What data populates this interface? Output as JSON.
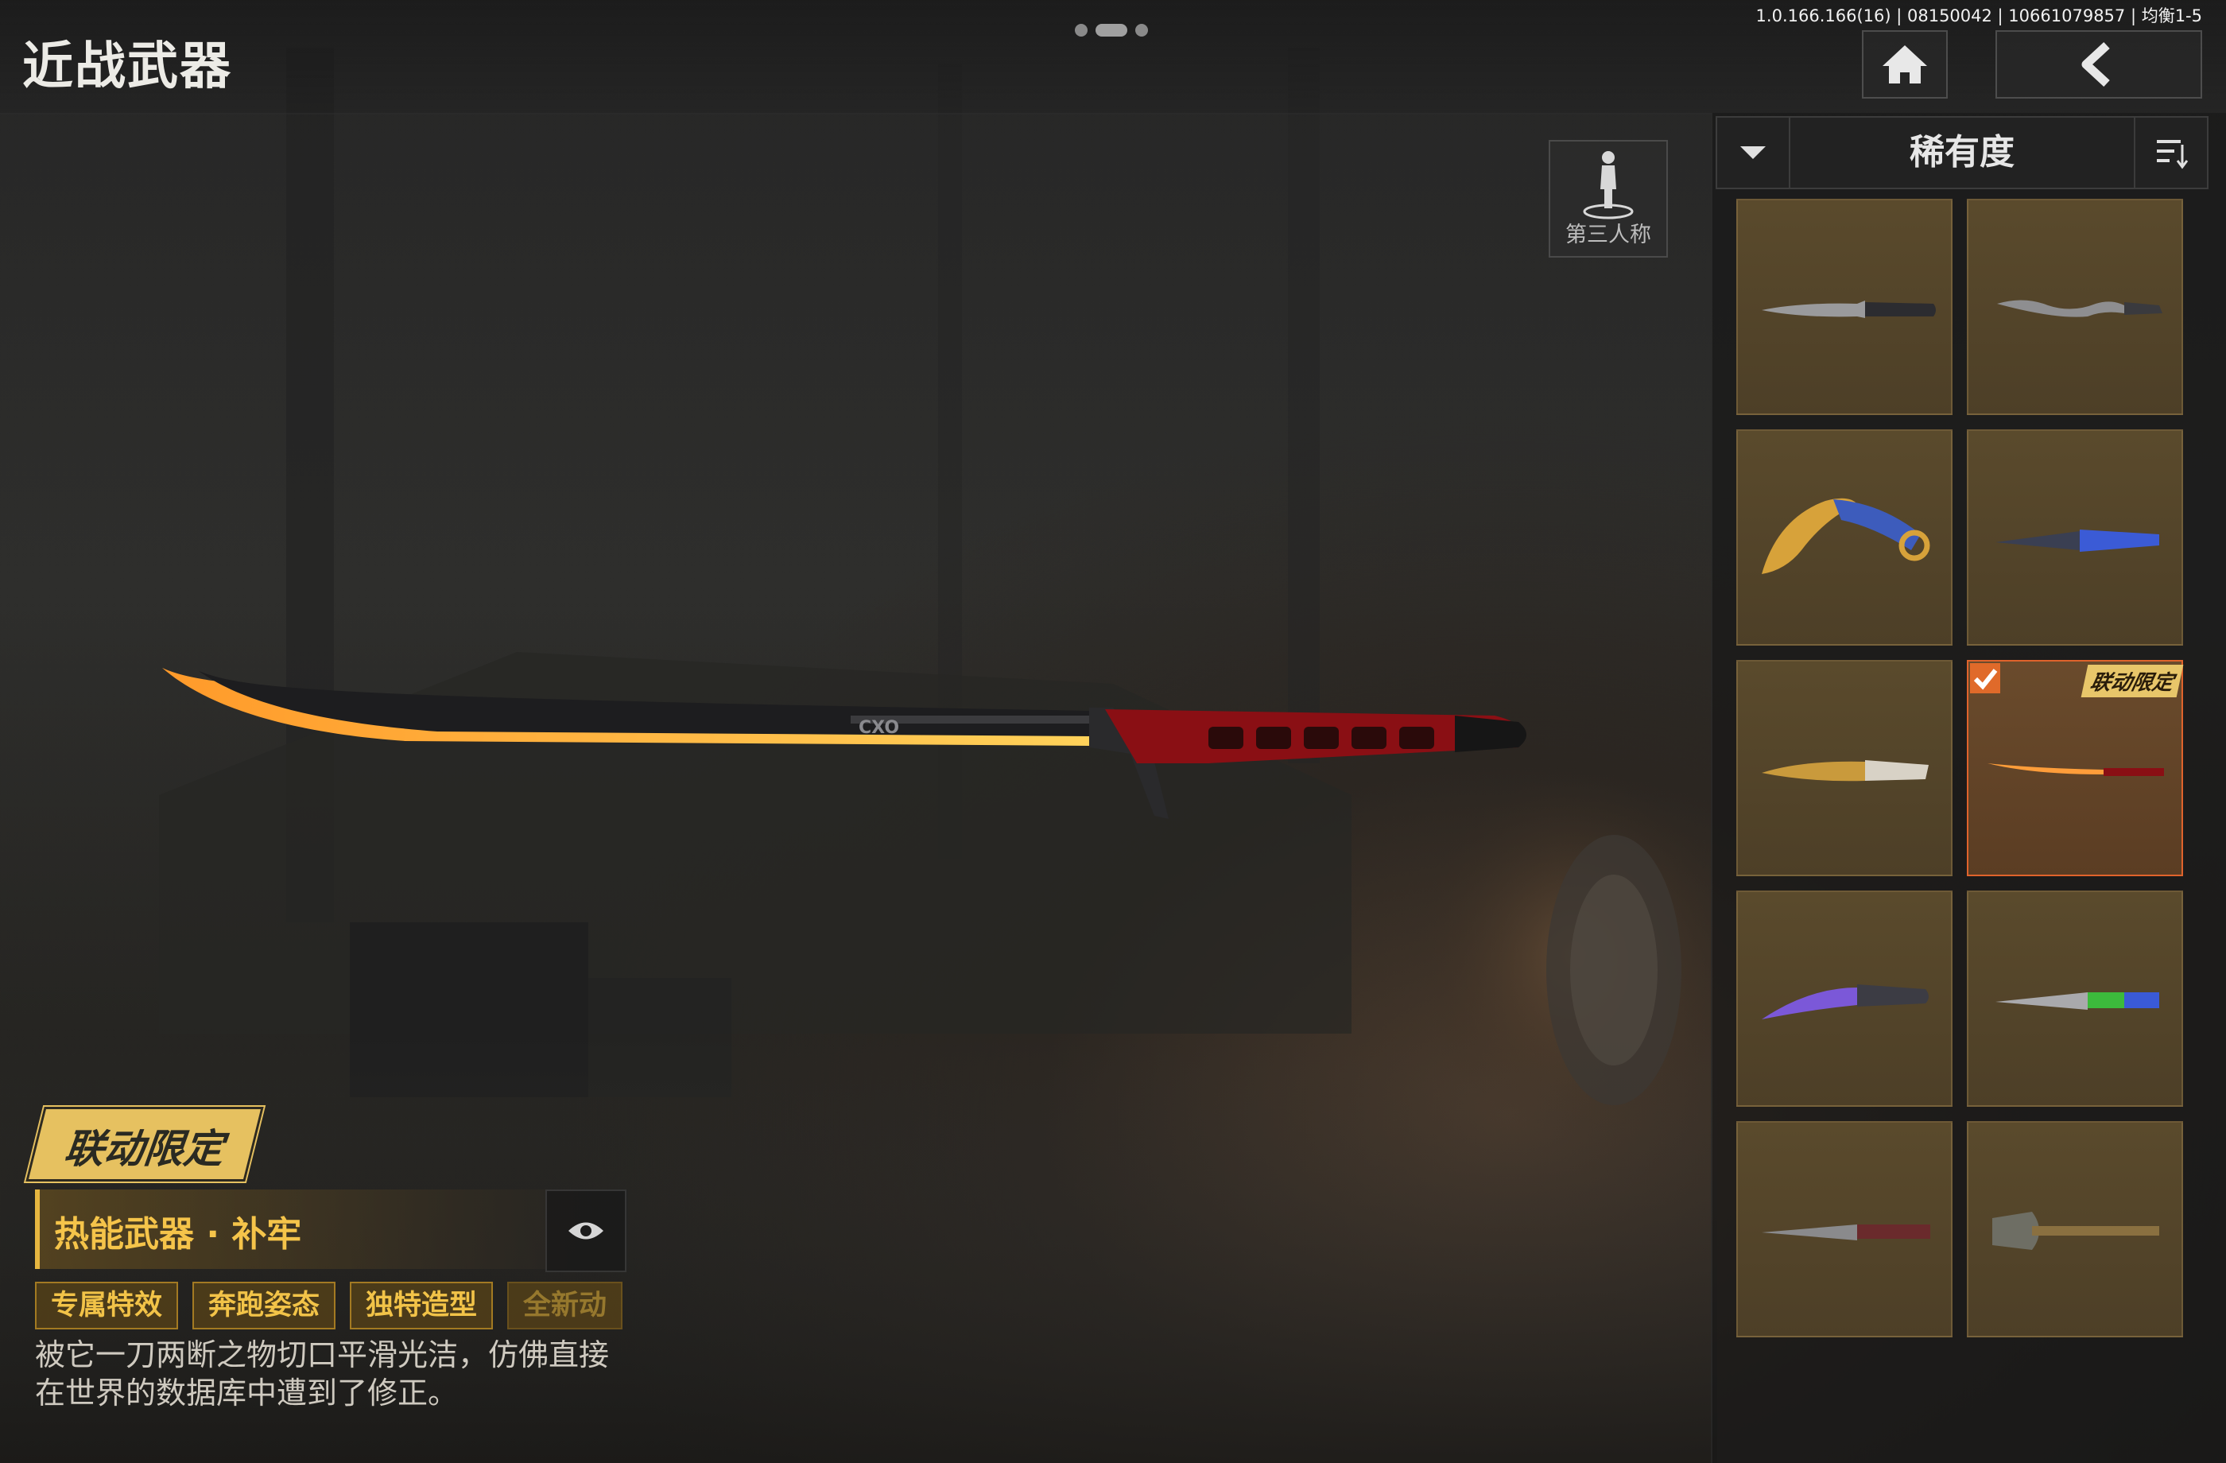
{
  "header": {
    "title": "近战武器",
    "version_info": "1.0.166.166(16) | 08150042 | 10661079857 | 均衡1-5"
  },
  "view_toggle": {
    "label": "第三人称"
  },
  "sort": {
    "label": "稀有度"
  },
  "weapon": {
    "badge": "联动限定",
    "name": "热能武器 · 补牢",
    "tags": [
      "专属特效",
      "奔跑姿态",
      "独特造型",
      "全新动"
    ],
    "description_line1": "被它一刀两断之物切口平滑光洁，仿佛直接",
    "description_line2": "在世界的数据库中遭到了修正。"
  },
  "grid": {
    "items": [
      {
        "name": "serrated-dagger"
      },
      {
        "name": "wavy-dagger"
      },
      {
        "name": "golden-karambit"
      },
      {
        "name": "blue-tactical-knife"
      },
      {
        "name": "golden-combat-knife"
      },
      {
        "name": "thermal-katana",
        "selected": true,
        "badge": "联动限定"
      },
      {
        "name": "purple-kukri"
      },
      {
        "name": "blue-bayonet"
      },
      {
        "name": "red-serrated-knife"
      },
      {
        "name": "shovel"
      }
    ]
  },
  "colors": {
    "accent_gold": "#f2c348",
    "selected_border": "#e0632c",
    "cell_bg": "#5a4a2c"
  }
}
